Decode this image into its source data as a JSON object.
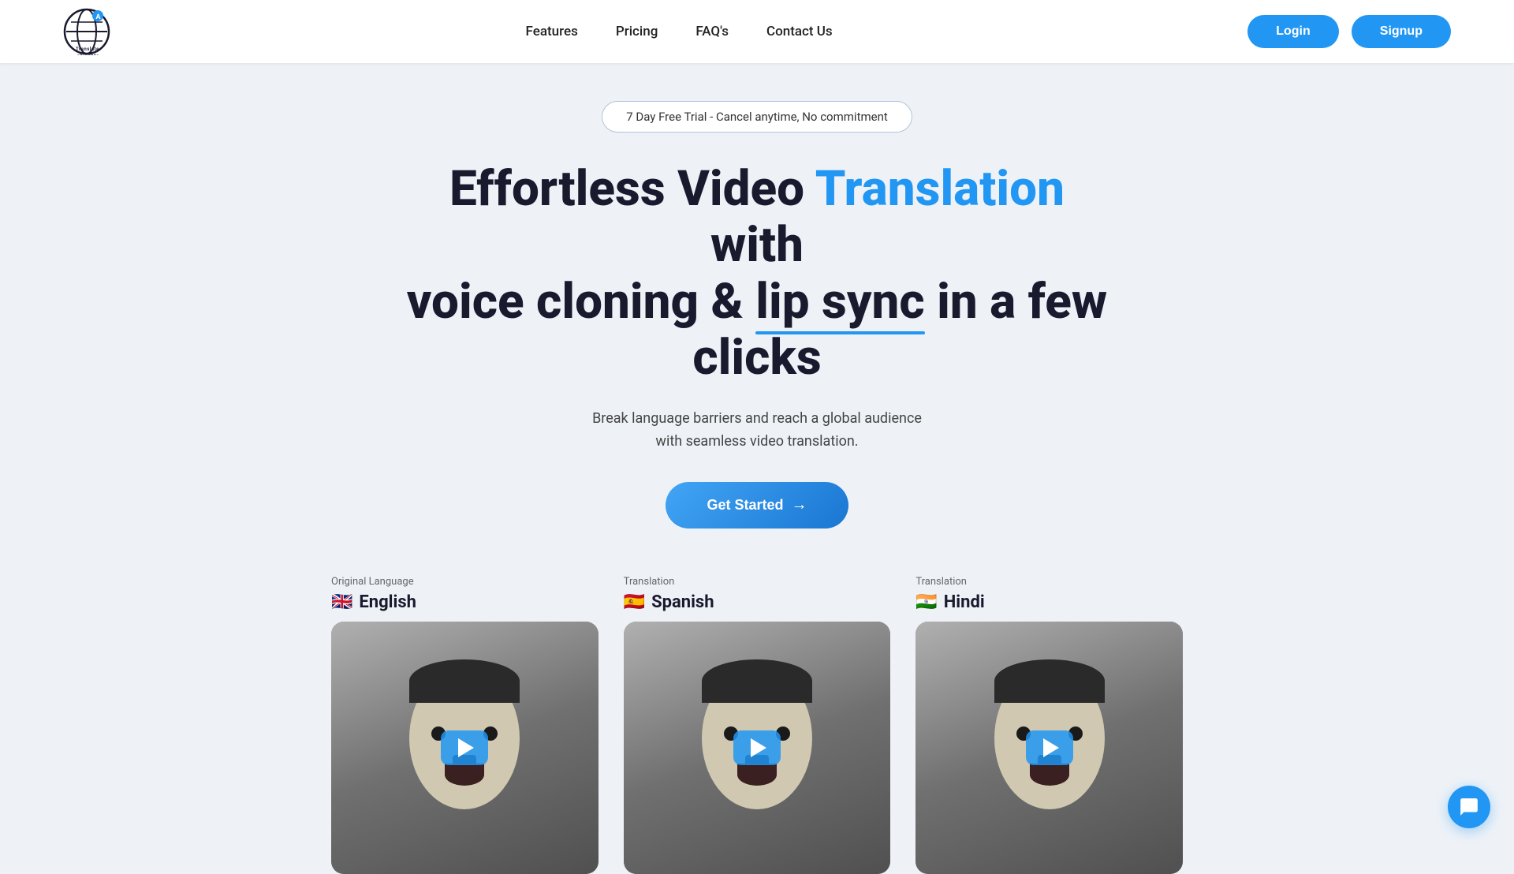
{
  "navbar": {
    "logo_alt": "Translate Videos Logo",
    "nav_items": [
      {
        "label": "Features",
        "href": "#"
      },
      {
        "label": "Pricing",
        "href": "#"
      },
      {
        "label": "FAQ's",
        "href": "#"
      },
      {
        "label": "Contact Us",
        "href": "#"
      }
    ],
    "login_label": "Login",
    "signup_label": "Signup"
  },
  "hero": {
    "trial_badge": "7 Day Free Trial - Cancel anytime, No commitment",
    "title_part1": "Effortless Video ",
    "title_highlight": "Translation",
    "title_part2": " with",
    "title_part3": "voice cloning & ",
    "title_underline": "lip sync",
    "title_part4": " in a few clicks",
    "subtitle_line1": "Break language barriers and reach a global audience",
    "subtitle_line2": "with seamless video translation.",
    "cta_label": "Get Started",
    "cta_arrow": "→"
  },
  "videos": [
    {
      "label": "Original Language",
      "flag": "🇬🇧",
      "language": "English"
    },
    {
      "label": "Translation",
      "flag": "🇪🇸",
      "language": "Spanish"
    },
    {
      "label": "Translation",
      "flag": "🇮🇳",
      "language": "Hindi"
    }
  ],
  "chat": {
    "icon_label": "chat-support-icon"
  }
}
